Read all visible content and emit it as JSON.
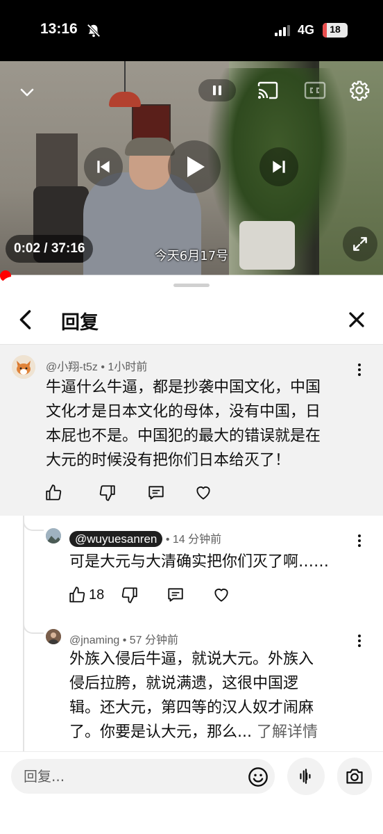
{
  "status_bar": {
    "time": "13:16",
    "network": "4G",
    "battery": "18",
    "battery_level": 0.18
  },
  "video": {
    "current_time": "0:02 / 37:16",
    "subtitle": "今天6月17号",
    "progress": 0.001
  },
  "sheet": {
    "title": "回复"
  },
  "parent_comment": {
    "author": "@小翔-t5z",
    "time": "1小时前",
    "lines": [
      "牛逼什么牛逼，都是抄袭中国文化，中国",
      "文化才是日本文化的母体，没有中国，日",
      "本屁也不是。中国犯的最大的错误就是在",
      "大元的时候没有把你们日本给灭了！"
    ]
  },
  "replies": [
    {
      "author": "@wuyuesanren",
      "time": "14 分钟前",
      "lines": [
        "可是大元与大清确实把你们灭了啊……"
      ],
      "likes": "18"
    },
    {
      "author": "@jnaming",
      "time": "57 分钟前",
      "lines": [
        "外族入侵后牛逼，就说大元。外族入",
        "侵后拉胯，就说满遗，这很中国逻",
        "辑。还大元，第四等的汉人奴才闹麻",
        "了。你要是认大元，那么..."
      ],
      "read_more": "了解详情"
    }
  ],
  "composer": {
    "placeholder": "回复..."
  }
}
